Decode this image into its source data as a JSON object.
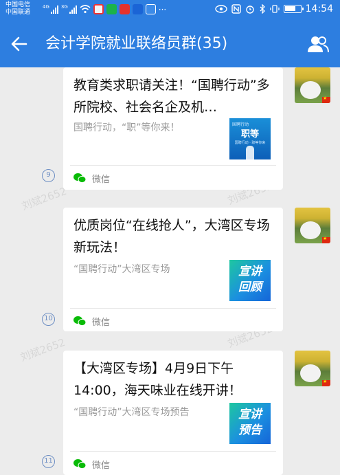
{
  "status_bar": {
    "carrier1": "中国电信",
    "carrier2": "中国联通",
    "net1": "4G",
    "net2": "3G",
    "more": "···",
    "time": "14:54"
  },
  "header": {
    "title": "会计学院就业联络员群(35)"
  },
  "watermark": "刘斌2652",
  "messages": [
    {
      "index": "9",
      "title": "教育类求职请关注！“国聘行动”多所院校、社会名企及机…",
      "desc": "国聘行动，“职”等你来！",
      "source": "微信",
      "thumb_text_top": "国聘行动",
      "thumb_text_main": "职等",
      "thumb_text_sub": "国聘行动 · 职等你来"
    },
    {
      "index": "10",
      "title": "优质岗位“在线抢人”，大湾区专场新玩法！",
      "desc": "“国聘行动”大湾区专场",
      "source": "微信",
      "thumb_text": "宣讲回顾"
    },
    {
      "index": "11",
      "title": "【大湾区专场】4月9日下午14:00，海天味业在线开讲！",
      "desc": "“国聘行动”大湾区专场预告",
      "source": "微信",
      "thumb_text": "宣讲预告"
    }
  ],
  "colors": {
    "header_blue": "#2d7ee0",
    "wechat_green": "#09bb07",
    "thumb_blue": "#1572e0"
  }
}
